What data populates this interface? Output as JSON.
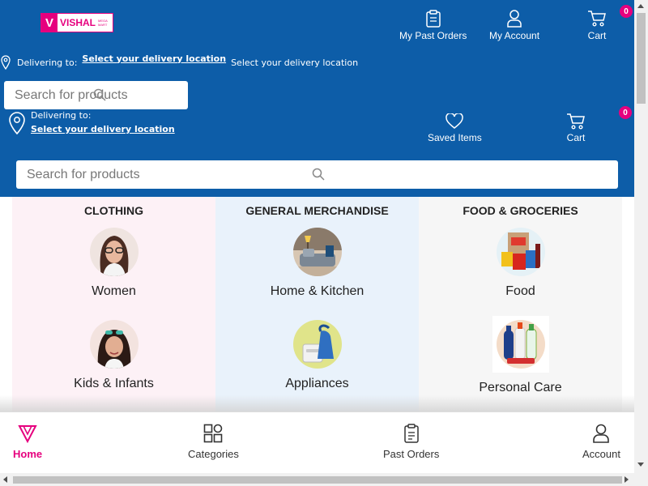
{
  "brand": {
    "logo_text": "VISHAL",
    "logo_sub": "MEGA MART",
    "accent": "#e6007e",
    "header_bg": "#0d5da8"
  },
  "top_nav": {
    "past_orders": "My Past Orders",
    "account": "My Account",
    "cart": "Cart",
    "cart_count": "0"
  },
  "location": {
    "delivering_label": "Delivering to:",
    "select_link": "Select your delivery location",
    "select_plain": "Select your delivery location"
  },
  "search": {
    "placeholder": "Search for products"
  },
  "secondary_nav": {
    "saved": "Saved Items",
    "cart": "Cart",
    "cart_count": "0"
  },
  "categories": [
    {
      "heading": "CLOTHING",
      "bg": "#fdf1f6",
      "items": [
        {
          "name": "Women",
          "icon": "women-image"
        },
        {
          "name": "Kids & Infants",
          "icon": "kids-image"
        }
      ]
    },
    {
      "heading": "GENERAL MERCHANDISE",
      "bg": "#e9f2fb",
      "items": [
        {
          "name": "Home & Kitchen",
          "icon": "home-kitchen-image"
        },
        {
          "name": "Appliances",
          "icon": "appliances-image"
        }
      ]
    },
    {
      "heading": "FOOD & GROCERIES",
      "bg": "#f6f6f6",
      "items": [
        {
          "name": "Food",
          "icon": "food-image"
        },
        {
          "name": "Personal Care",
          "icon": "personal-care-image"
        }
      ]
    }
  ],
  "bottom_nav": {
    "home": "Home",
    "categories": "Categories",
    "past_orders": "Past Orders",
    "account": "Account"
  }
}
